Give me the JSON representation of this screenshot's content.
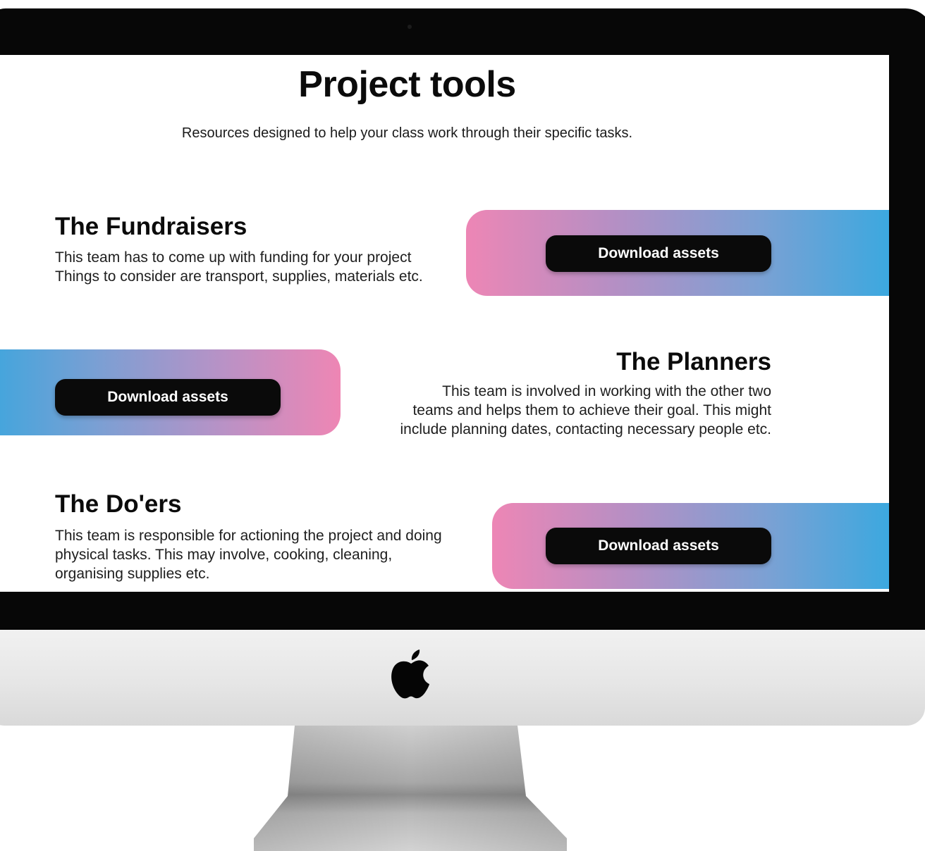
{
  "page": {
    "title": "Project tools",
    "subtitle": "Resources designed to help your class work through their specific tasks."
  },
  "teams": [
    {
      "title": "The Fundraisers",
      "description_lines": [
        "This team has to come up with funding for your project",
        "Things to consider are transport, supplies, materials etc."
      ],
      "button_label": "Download assets"
    },
    {
      "title": "The Planners",
      "description_lines": [
        "This team is involved in working with the other two",
        "teams and helps them to achieve their goal. This might",
        "include planning dates, contacting necessary people etc."
      ],
      "button_label": "Download assets"
    },
    {
      "title": "The Do'ers",
      "description_lines": [
        "This team is responsible for actioning the project and doing",
        "physical tasks. This may involve, cooking, cleaning,",
        "organising supplies etc."
      ],
      "button_label": "Download assets"
    }
  ],
  "colors": {
    "accent_pink": "#ed86b5",
    "accent_blue": "#3ca8df",
    "button_bg": "#0a0a0a",
    "button_text": "#ffffff"
  },
  "icons": {
    "monitor_logo": "apple-logo-icon"
  }
}
